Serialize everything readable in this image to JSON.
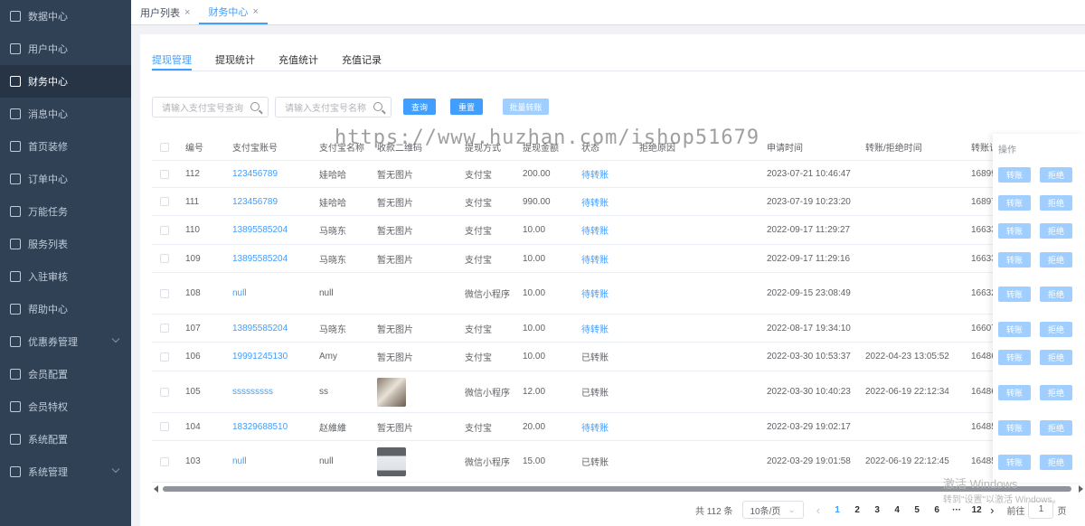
{
  "sidebar": {
    "items": [
      {
        "label": "数据中心"
      },
      {
        "label": "用户中心"
      },
      {
        "label": "财务中心"
      },
      {
        "label": "消息中心"
      },
      {
        "label": "首页装修"
      },
      {
        "label": "订单中心"
      },
      {
        "label": "万能任务"
      },
      {
        "label": "服务列表"
      },
      {
        "label": "入驻审核"
      },
      {
        "label": "帮助中心"
      },
      {
        "label": "优惠券管理"
      },
      {
        "label": "会员配置"
      },
      {
        "label": "会员特权"
      },
      {
        "label": "系统配置"
      },
      {
        "label": "系统管理"
      }
    ]
  },
  "tabs": [
    {
      "label": "用户列表",
      "close": "×"
    },
    {
      "label": "财务中心",
      "close": "×"
    }
  ],
  "subtabs": [
    {
      "label": "提现管理"
    },
    {
      "label": "提现统计"
    },
    {
      "label": "充值统计"
    },
    {
      "label": "充值记录"
    }
  ],
  "filters": {
    "query_placeholder": "请输入支付宝号查询",
    "name_placeholder": "请输入支付宝号名称",
    "search_label": "查询",
    "reset_label": "重置",
    "batch_label": "批量转账"
  },
  "table": {
    "headers": {
      "id": "编号",
      "account": "支付宝账号",
      "name": "支付宝名称",
      "qrcode": "收款二维码",
      "method": "提现方式",
      "amount": "提现金额",
      "status": "状态",
      "reason": "拒绝原因",
      "apply_time": "申请时间",
      "handle_time": "转账/拒绝时间",
      "order_no": "转账订",
      "ops": "操作"
    },
    "rows": [
      {
        "id": "112",
        "account": "123456789",
        "name": "娃哈哈",
        "qrcode": "暂无图片",
        "method": "支付宝",
        "amount": "200.00",
        "status": "待转账",
        "apply_time": "2023-07-21 10:46:47",
        "handle_time": "",
        "order_no": "16899"
      },
      {
        "id": "111",
        "account": "123456789",
        "name": "娃哈哈",
        "qrcode": "暂无图片",
        "method": "支付宝",
        "amount": "990.00",
        "status": "待转账",
        "apply_time": "2023-07-19 10:23:20",
        "handle_time": "",
        "order_no": "16897"
      },
      {
        "id": "110",
        "account": "13895585204",
        "name": "马晓东",
        "qrcode": "暂无图片",
        "method": "支付宝",
        "amount": "10.00",
        "status": "待转账",
        "apply_time": "2022-09-17 11:29:27",
        "handle_time": "",
        "order_no": "16633"
      },
      {
        "id": "109",
        "account": "13895585204",
        "name": "马晓东",
        "qrcode": "暂无图片",
        "method": "支付宝",
        "amount": "10.00",
        "status": "待转账",
        "apply_time": "2022-09-17 11:29:16",
        "handle_time": "",
        "order_no": "16633"
      },
      {
        "id": "108",
        "account": "null",
        "name": "null",
        "qrcode": "",
        "method": "微信小程序",
        "amount": "10.00",
        "status": "待转账",
        "apply_time": "2022-09-15 23:08:49",
        "handle_time": "",
        "order_no": "16632"
      },
      {
        "id": "107",
        "account": "13895585204",
        "name": "马晓东",
        "qrcode": "暂无图片",
        "method": "支付宝",
        "amount": "10.00",
        "status": "待转账",
        "apply_time": "2022-08-17 19:34:10",
        "handle_time": "",
        "order_no": "16607"
      },
      {
        "id": "106",
        "account": "19991245130",
        "name": "Amy",
        "qrcode": "暂无图片",
        "method": "支付宝",
        "amount": "10.00",
        "status": "已转账",
        "apply_time": "2022-03-30 10:53:37",
        "handle_time": "2022-04-23 13:05:52",
        "order_no": "16486"
      },
      {
        "id": "105",
        "account": "sssssssss",
        "name": "ss",
        "qrcode": "",
        "method": "微信小程序",
        "amount": "12.00",
        "status": "已转账",
        "apply_time": "2022-03-30 10:40:23",
        "handle_time": "2022-06-19 22:12:34",
        "order_no": "16486"
      },
      {
        "id": "104",
        "account": "18329688510",
        "name": "赵維維",
        "qrcode": "暂无图片",
        "method": "支付宝",
        "amount": "20.00",
        "status": "待转账",
        "apply_time": "2022-03-29 19:02:17",
        "handle_time": "",
        "order_no": "16485"
      },
      {
        "id": "103",
        "account": "null",
        "name": "null",
        "qrcode": "",
        "method": "微信小程序",
        "amount": "15.00",
        "status": "已转账",
        "apply_time": "2022-03-29 19:01:58",
        "handle_time": "2022-06-19 22:12:45",
        "order_no": "16485"
      }
    ],
    "ops": {
      "transfer": "转账",
      "reject": "拒绝"
    }
  },
  "pagination": {
    "total": "共 112 条",
    "page_size": "10条/页",
    "pages": [
      "1",
      "2",
      "3",
      "4",
      "5",
      "6",
      "···",
      "12"
    ],
    "current": "1",
    "goto_label": "前往",
    "goto_value": "1",
    "page_suffix": "页"
  },
  "watermark": "https://www.huzhan.com/ishop51679",
  "windows_activation": {
    "title": "激活 Windows",
    "subtitle": "转到\"设置\"以激活 Windows。"
  },
  "colors": {
    "sidebar_bg": "#304156",
    "accent": "#409eff",
    "accent_light": "#a0cfff"
  }
}
